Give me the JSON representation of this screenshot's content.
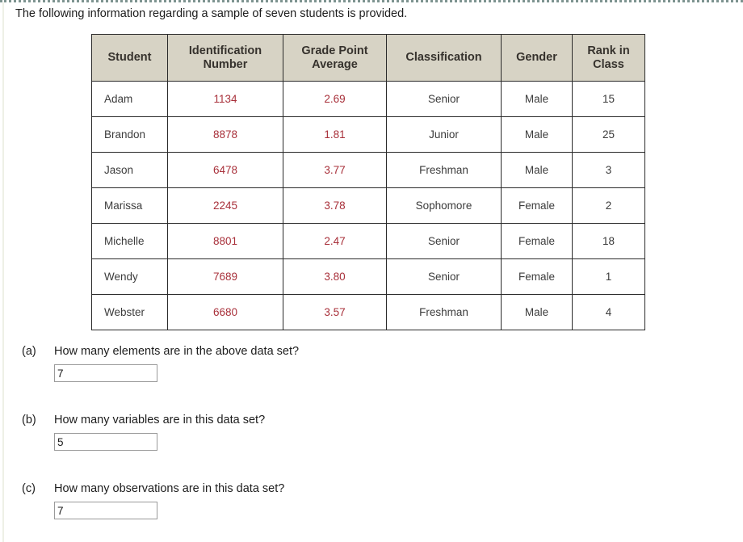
{
  "intro": {
    "text": "The following information regarding a sample of seven students is provided."
  },
  "colors": {
    "header_background": "#d7d3c5",
    "header_text": "#36322d",
    "numeric_accent": "#a8303a",
    "table_border": "#2b2b2b",
    "body_text": "#3c3c3c",
    "page_background": "#ffffff",
    "top_rule": "#7d9390",
    "input_border": "#9a9a9a"
  },
  "table": {
    "columns": [
      {
        "key": "student",
        "label": "Student"
      },
      {
        "key": "id",
        "label": "Identification Number"
      },
      {
        "key": "gpa",
        "label": "Grade Point Average"
      },
      {
        "key": "classification",
        "label": "Classification"
      },
      {
        "key": "gender",
        "label": "Gender"
      },
      {
        "key": "rank",
        "label": "Rank in Class"
      }
    ],
    "header_lines": {
      "student": [
        "Student"
      ],
      "id": [
        "Identification",
        "Number"
      ],
      "gpa": [
        "Grade Point",
        "Average"
      ],
      "classification": [
        "Classification"
      ],
      "gender": [
        "Gender"
      ],
      "rank": [
        "Rank in",
        "Class"
      ]
    },
    "rows": [
      {
        "student": "Adam",
        "id": "1134",
        "gpa": "2.69",
        "classification": "Senior",
        "gender": "Male",
        "rank": "15"
      },
      {
        "student": "Brandon",
        "id": "8878",
        "gpa": "1.81",
        "classification": "Junior",
        "gender": "Male",
        "rank": "25"
      },
      {
        "student": "Jason",
        "id": "6478",
        "gpa": "3.77",
        "classification": "Freshman",
        "gender": "Male",
        "rank": "3"
      },
      {
        "student": "Marissa",
        "id": "2245",
        "gpa": "3.78",
        "classification": "Sophomore",
        "gender": "Female",
        "rank": "2"
      },
      {
        "student": "Michelle",
        "id": "8801",
        "gpa": "2.47",
        "classification": "Senior",
        "gender": "Female",
        "rank": "18"
      },
      {
        "student": "Wendy",
        "id": "7689",
        "gpa": "3.80",
        "classification": "Senior",
        "gender": "Female",
        "rank": "1"
      },
      {
        "student": "Webster",
        "id": "6680",
        "gpa": "3.57",
        "classification": "Freshman",
        "gender": "Male",
        "rank": "4"
      }
    ]
  },
  "questions": [
    {
      "label": "(a)",
      "prompt": "How many elements are in the above data set?",
      "answer": "7",
      "placeholder": ""
    },
    {
      "label": "(b)",
      "prompt": "How many variables are in this data set?",
      "answer": "5",
      "placeholder": ""
    },
    {
      "label": "(c)",
      "prompt": "How many observations are in this data set?",
      "answer": "7",
      "placeholder": ""
    }
  ]
}
